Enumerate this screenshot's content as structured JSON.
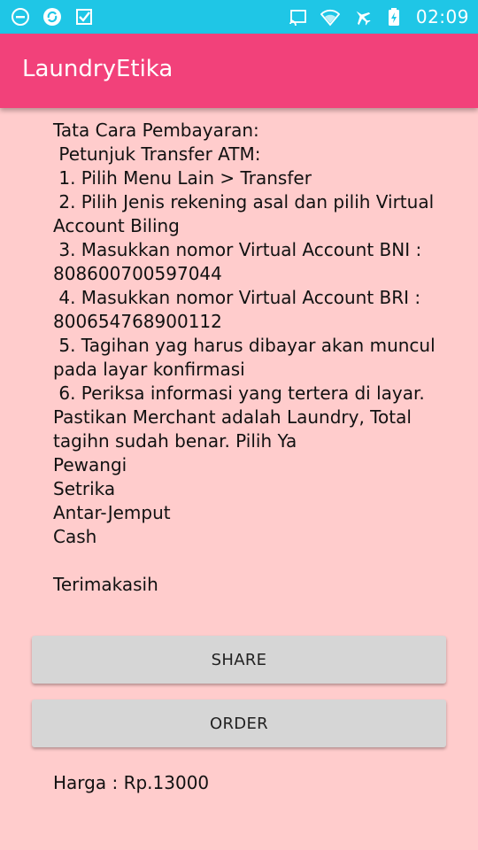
{
  "status_bar": {
    "time": "02:09",
    "icons_left": [
      "minus-circle-icon",
      "sync-circle-icon",
      "check-badge-icon"
    ],
    "icons_right": [
      "cast-icon",
      "wifi-icon",
      "airplane-mode-icon",
      "battery-charging-icon"
    ]
  },
  "app_bar": {
    "title": "LaundryEtika",
    "color": "#f2417a"
  },
  "content": {
    "text": "Tata Cara Pembayaran:\n Petunjuk Transfer ATM:\n 1. Pilih Menu Lain > Transfer\n 2. Pilih Jenis rekening asal dan pilih Virtual Account Biling\n 3. Masukkan nomor Virtual Account BNI : 808600700597044\n 4. Masukkan nomor Virtual Account BRI : 800654768900112\n 5. Tagihan yag harus dibayar akan muncul pada layar konfirmasi\n 6. Periksa informasi yang tertera di layar. Pastikan Merchant adalah Laundry, Total tagihn sudah benar. Pilih Ya\nPewangi\nSetrika\nAntar-Jemput\nCash\n\nTerimakasih",
    "background": "#ffcccc"
  },
  "buttons": {
    "share_label": "SHARE",
    "order_label": "ORDER"
  },
  "price": {
    "label": "Harga : Rp.13000"
  },
  "colors": {
    "status_bar": "#1fc6e6",
    "accent": "#f2417a",
    "button": "#d6d6d6"
  }
}
